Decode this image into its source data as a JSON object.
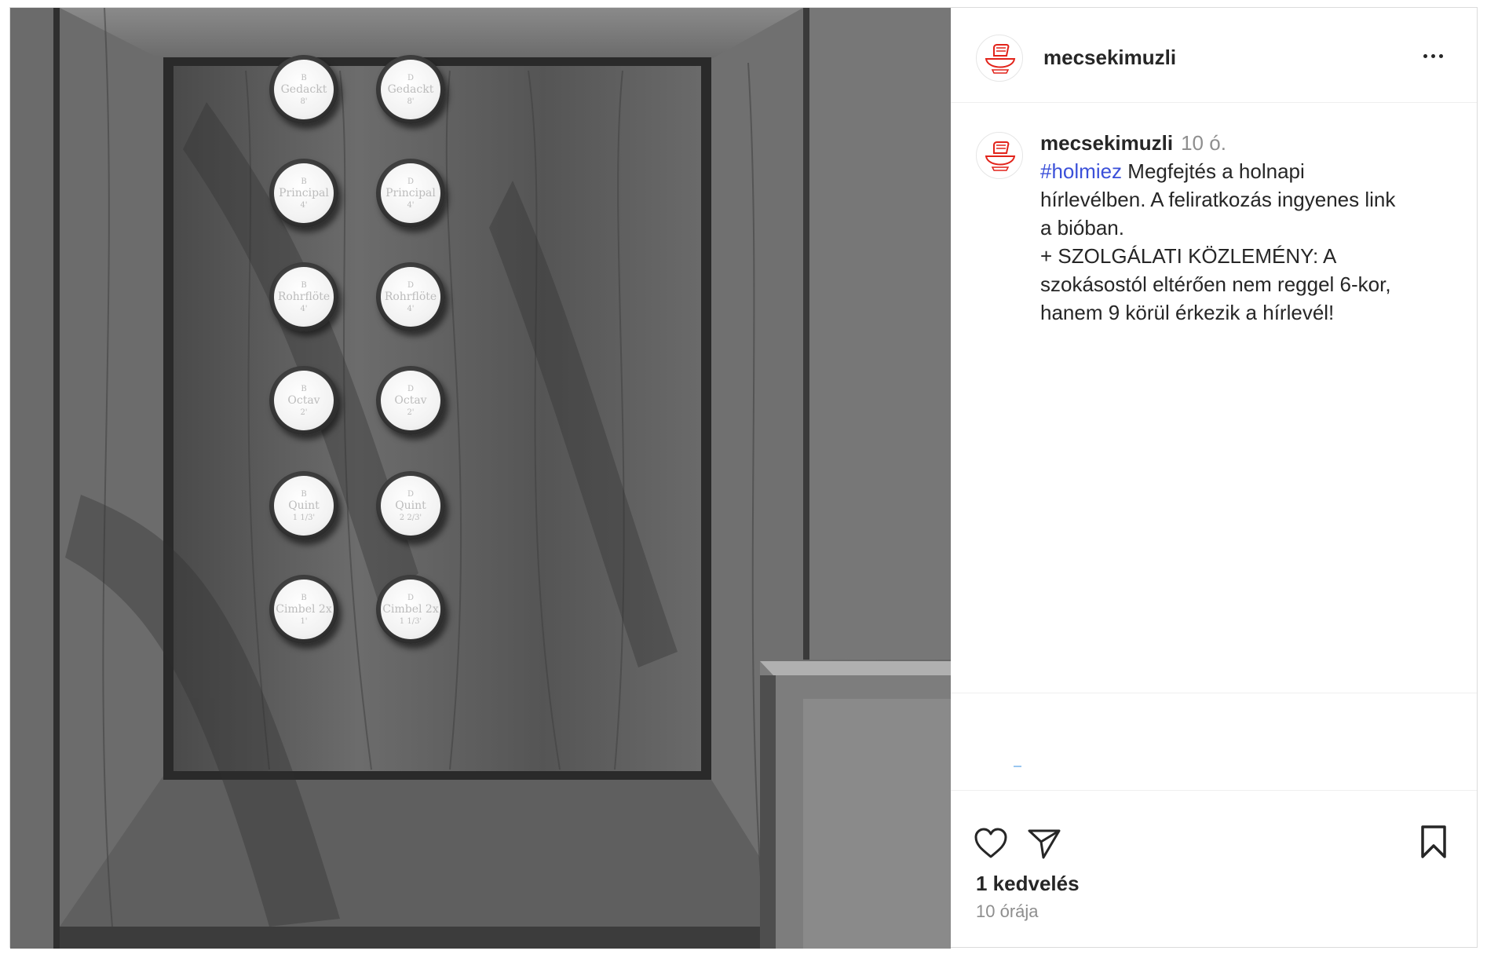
{
  "post": {
    "username": "mecsekimuzli",
    "more_label": "More options",
    "caption": {
      "username": "mecsekimuzli",
      "time_short": "10 ó.",
      "hashtag": "#holmiez",
      "lines": [
        " Megfejtés a holnapi",
        "hírlevélben. A feliratkozás ingyenes link",
        "a bióban.",
        "+ SZOLGÁLATI KÖZLEMÉNY: A",
        "szokásostól eltérően nem reggel 6-kor,",
        "hanem 9 körül érkezik a hírlevél!"
      ]
    },
    "likes_text": "1 kedvelés",
    "time_text": "10 órája",
    "icons": {
      "like": "heart-icon",
      "share": "paper-plane-icon",
      "save": "bookmark-icon",
      "more": "more-horizontal-icon",
      "avatar": "bowl-fist-logo"
    },
    "colors": {
      "hashtag": "#3b50d9",
      "logo_red": "#e2231a",
      "muted": "#8e8e8e"
    }
  },
  "photo": {
    "knobs": [
      {
        "letter": "B",
        "name": "Gedackt",
        "size": "8'"
      },
      {
        "letter": "D",
        "name": "Gedackt",
        "size": "8'"
      },
      {
        "letter": "B",
        "name": "Principal",
        "size": "4'"
      },
      {
        "letter": "D",
        "name": "Principal",
        "size": "4'"
      },
      {
        "letter": "B",
        "name": "Rohrflöte",
        "size": "4'"
      },
      {
        "letter": "D",
        "name": "Rohrflöte",
        "size": "4'"
      },
      {
        "letter": "B",
        "name": "Octav",
        "size": "2'"
      },
      {
        "letter": "D",
        "name": "Octav",
        "size": "2'"
      },
      {
        "letter": "B",
        "name": "Quint",
        "size": "1 1/3'"
      },
      {
        "letter": "D",
        "name": "Quint",
        "size": "2 2/3'"
      },
      {
        "letter": "B",
        "name": "Cimbel 2x",
        "size": "1'"
      },
      {
        "letter": "D",
        "name": "Cimbel 2x",
        "size": "1 1/3'"
      }
    ]
  }
}
